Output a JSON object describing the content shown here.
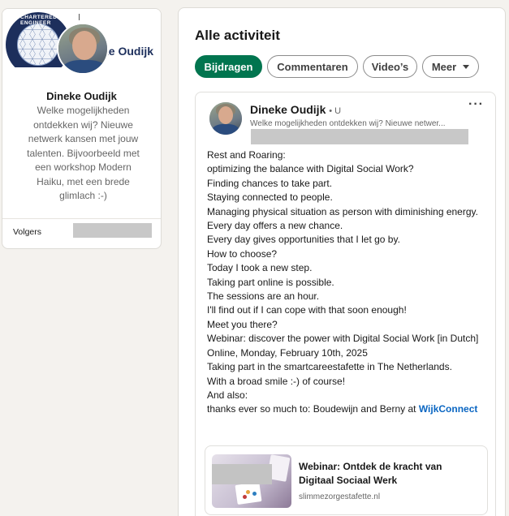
{
  "profile": {
    "banner_seal_text": "CHARTERED ENGINEER",
    "banner_title": "ke Oudijk",
    "name": "Dineke Oudijk",
    "headline": "Welke mogelijkheden ontdekken wij? Nieuwe netwerk kansen met jouw talenten. Bijvoorbeeld met een workshop Modern Haiku, met een brede glimlach :-)",
    "followers_label": "Volgers"
  },
  "activity": {
    "title": "Alle activiteit",
    "filters": [
      {
        "label": "Bijdragen",
        "active": true
      },
      {
        "label": "Commentaren",
        "active": false
      },
      {
        "label": "Video’s",
        "active": false
      },
      {
        "label": "Meer",
        "active": false
      }
    ]
  },
  "post": {
    "author": "Dineke Oudijk",
    "degree": "• U",
    "author_subtitle": "Welke mogelijkheden ontdekken wij? Nieuwe netwer...",
    "more_icon": "ellipsis-icon",
    "lines": [
      "Rest and Roaring:",
      "optimizing the balance with Digital Social Work?",
      "Finding chances to take part.",
      "Staying connected to people.",
      "Managing physical situation as person with diminishing energy.",
      "Every day offers a new chance.",
      "Every day gives opportunities that I let go by.",
      "How to choose?",
      "Today I took a new step.",
      "Taking part online is possible.",
      "The sessions are an hour.",
      "I'll find out if I can cope with that soon enough!",
      "Meet you there?",
      "Webinar: discover the power with Digital Social Work [in Dutch]",
      "Online, Monday, February 10th, 2025",
      "Taking part in the smartcareestafette in The Netherlands.",
      "With a broad smile :-) of course!",
      "And also:"
    ],
    "last_line_prefix": "thanks ever so much to: Boudewijn and Berny at ",
    "last_line_mention": "WijkConnect",
    "link": {
      "title": "Webinar: Ontdek de kracht van Digitaal Sociaal Werk",
      "domain": "slimmezorgestafette.nl"
    }
  },
  "colors": {
    "accent_green": "#01754f",
    "mention_blue": "#0a66c2",
    "page_bg": "#f4f2ee"
  }
}
